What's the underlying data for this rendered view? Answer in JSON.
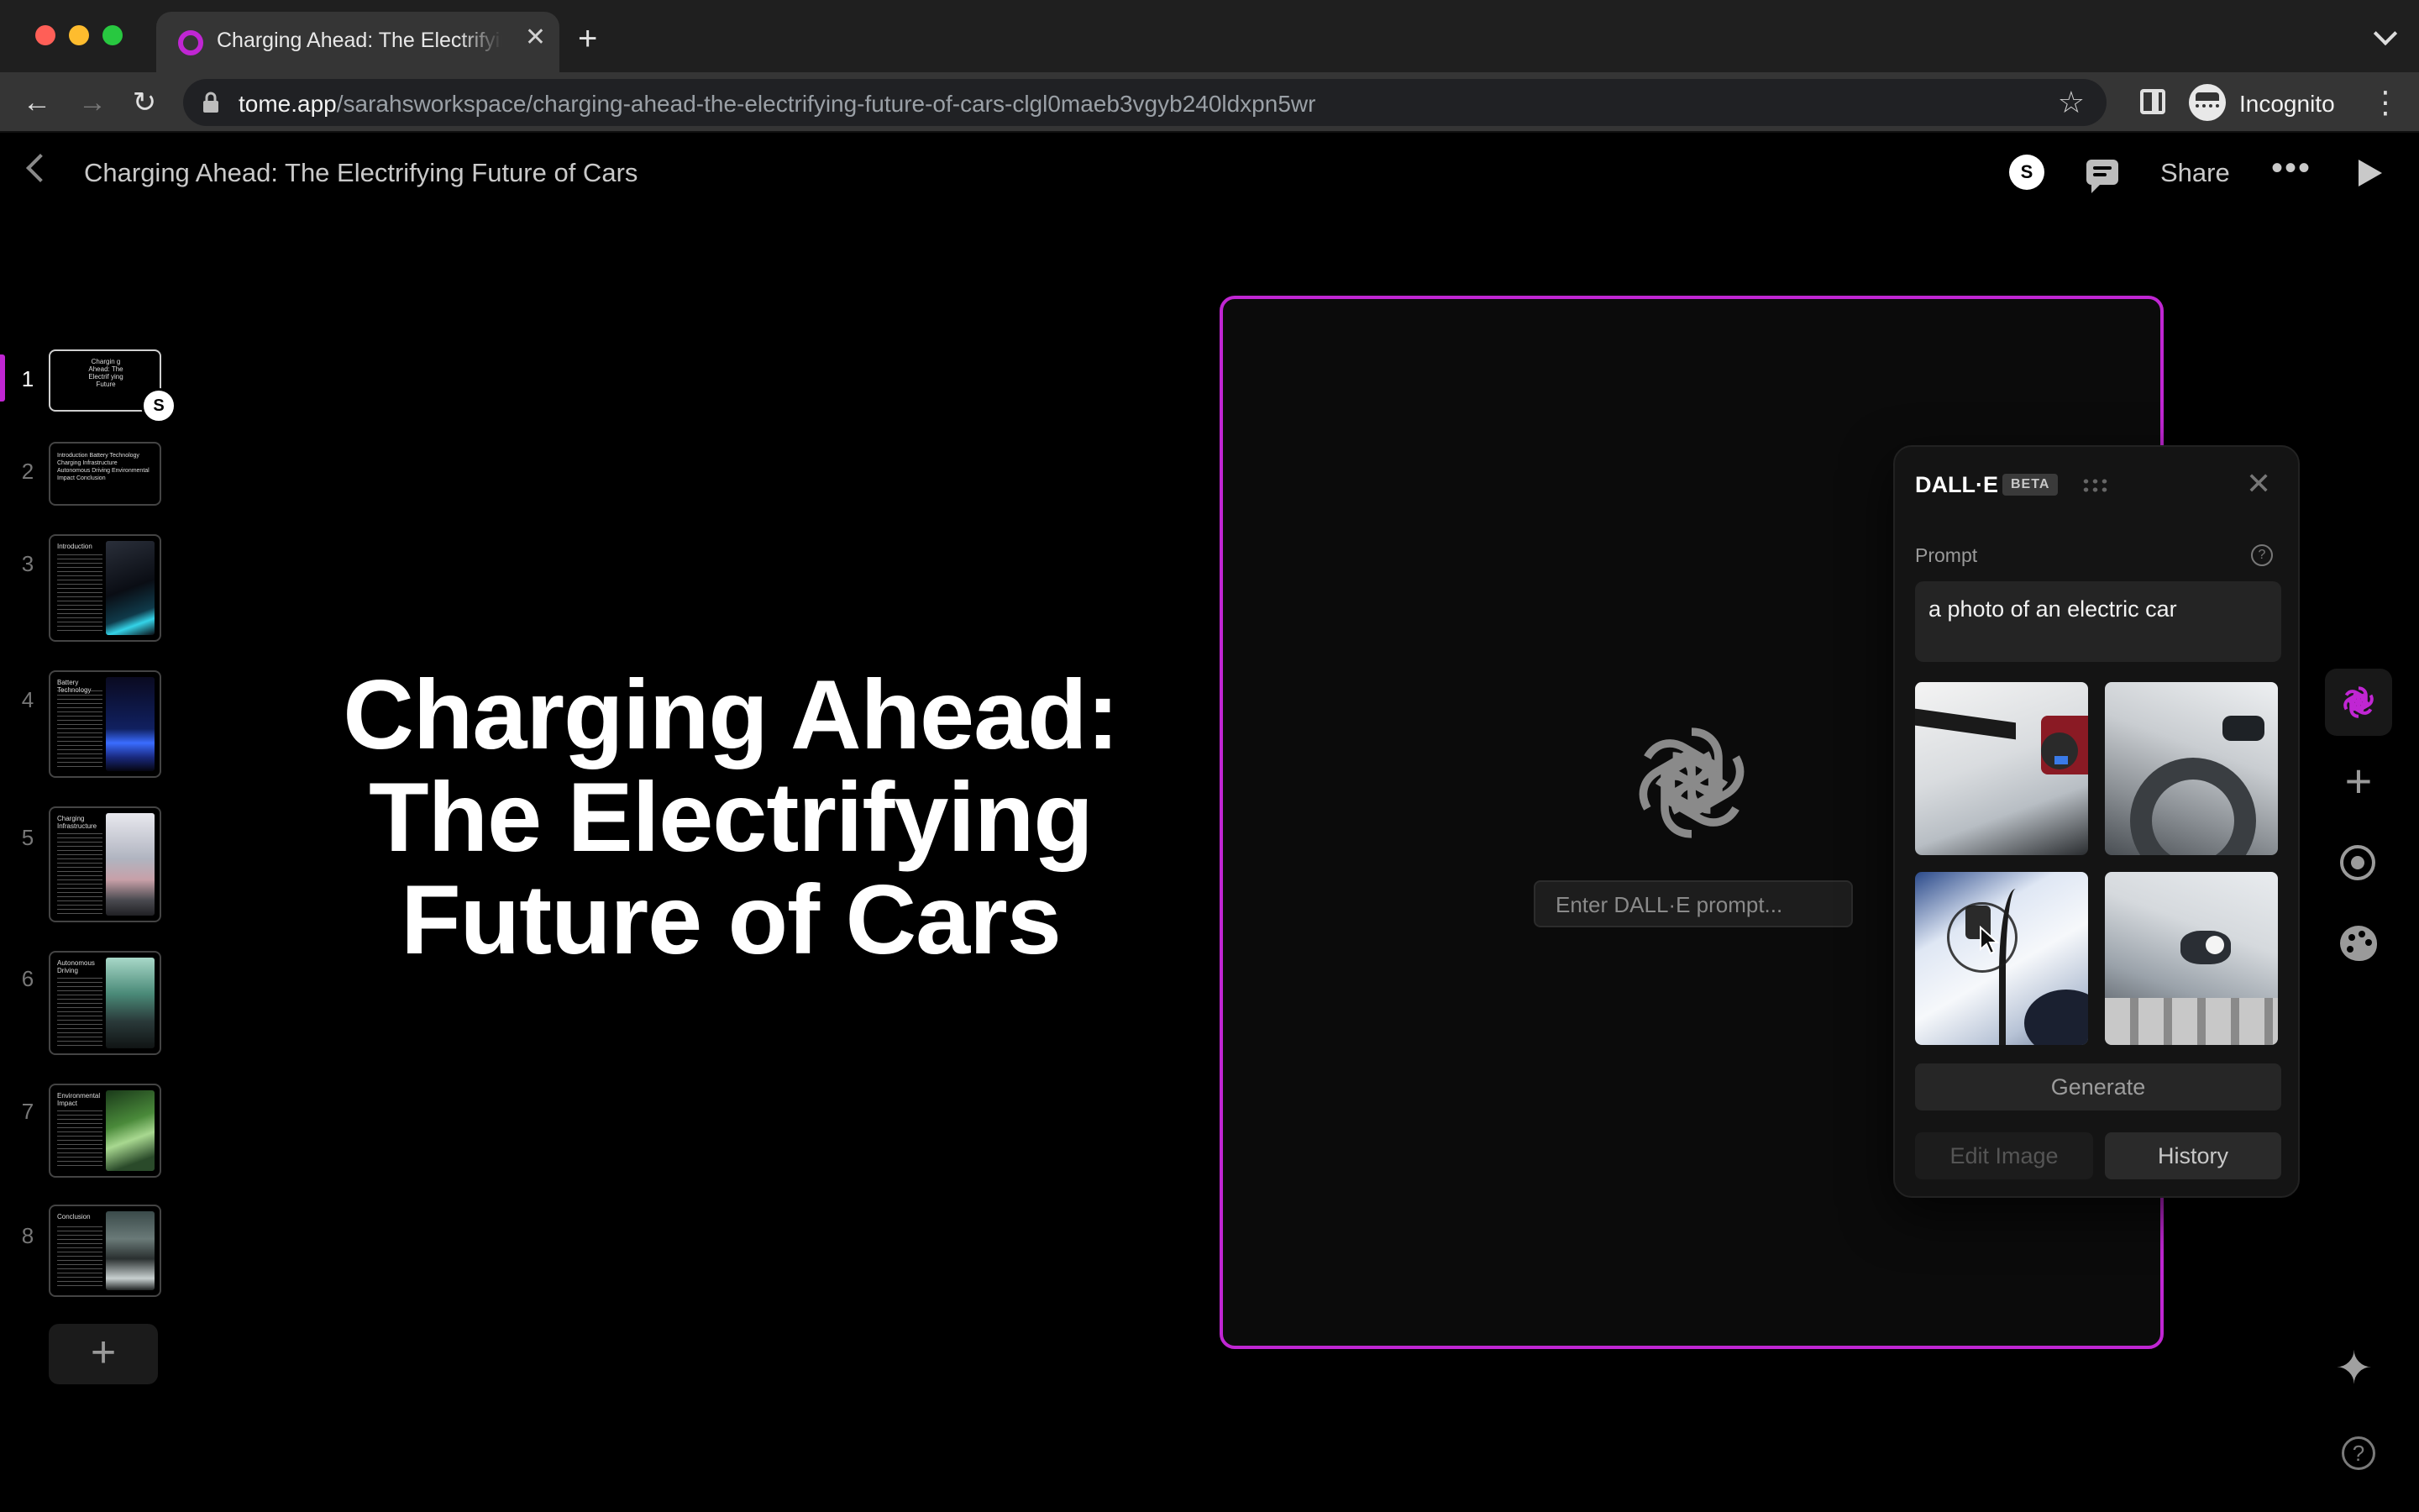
{
  "browser": {
    "tab_title": "Charging Ahead: The Electrifying Future of Cars",
    "tab_close": "✕",
    "new_tab": "+",
    "url_host": "tome.app",
    "url_path": "/sarahsworkspace/charging-ahead-the-electrifying-future-of-cars-clgl0maeb3vgyb240ldxpn5wr",
    "profile_label": "Incognito",
    "accent": "#c026d3"
  },
  "header": {
    "title": "Charging Ahead: The Electrifying Future of Cars",
    "avatar_initial": "S",
    "share_label": "Share",
    "more_label": "•••"
  },
  "rail": {
    "slides": [
      {
        "number": "1",
        "thumb_text": "Chargin g Ahead: The Electrif ying Future"
      },
      {
        "number": "2",
        "thumb_text": "Introduction Battery Technology Charging Infrastructure Autonomous Driving Environmental Impact Conclusion"
      },
      {
        "number": "3",
        "thumb_text": "Introduction"
      },
      {
        "number": "4",
        "thumb_text": "Battery Technology"
      },
      {
        "number": "5",
        "thumb_text": "Charging Infrastructure"
      },
      {
        "number": "6",
        "thumb_text": "Autonomous Driving"
      },
      {
        "number": "7",
        "thumb_text": "Environmental Impact"
      },
      {
        "number": "8",
        "thumb_text": "Conclusion"
      }
    ],
    "presence_initial": "S",
    "add_slide": "+"
  },
  "slide": {
    "title_lines": [
      "Charging Ahead:",
      "The Electrifying",
      "Future of Cars"
    ],
    "dalle_input_placeholder": "Enter DALL·E prompt..."
  },
  "dalle_panel": {
    "title": "DALL·E",
    "badge": "BETA",
    "close": "✕",
    "prompt_label": "Prompt",
    "help": "?",
    "prompt_value": "a photo of an electric car",
    "generate_label": "Generate",
    "edit_label": "Edit Image",
    "history_label": "History"
  },
  "tools": {
    "add": "+",
    "sparkle": "✦",
    "help": "?"
  }
}
